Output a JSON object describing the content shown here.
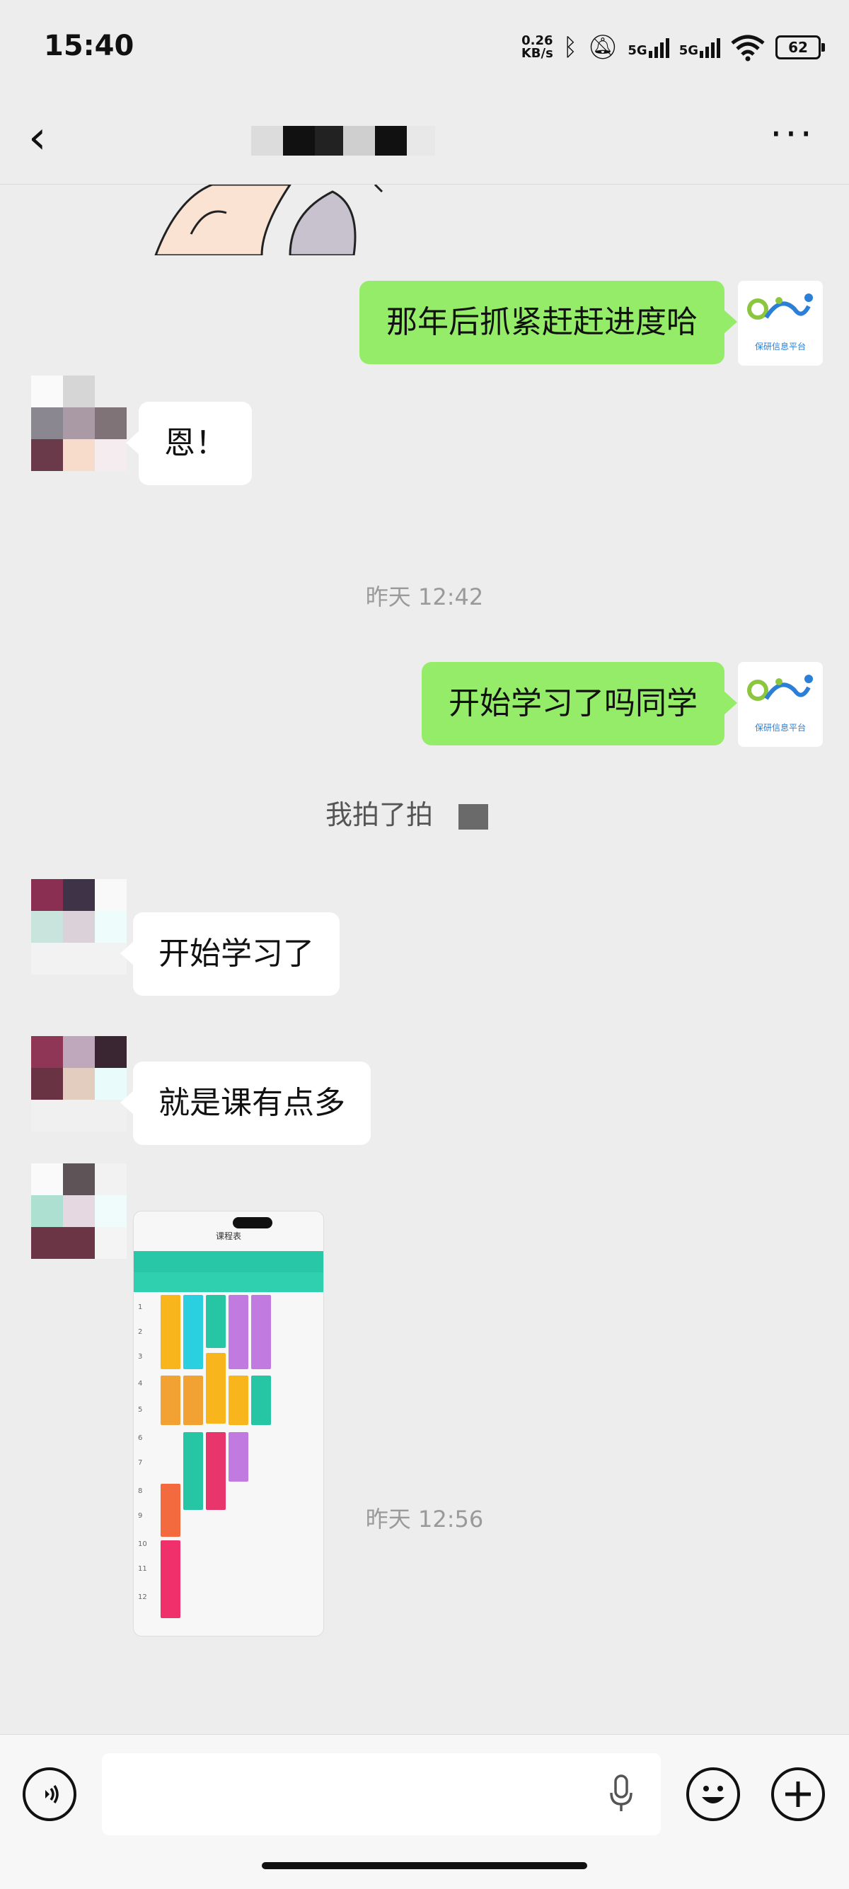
{
  "status_bar": {
    "time": "15:40",
    "net_speed_value": "0.26",
    "net_speed_unit": "KB/s",
    "sim1": "5G",
    "sim2": "5G",
    "battery": "62",
    "icons": [
      "bluetooth-icon",
      "mute-bell-icon",
      "signal-icon",
      "wifi-icon",
      "battery-icon"
    ]
  },
  "header": {
    "back_icon": "‹",
    "more_icon": "···"
  },
  "messages": [
    {
      "side": "out",
      "text": "那年后抓紧赶赶进度哈"
    },
    {
      "side": "in",
      "text": "恩！"
    },
    {
      "type": "time",
      "text": "昨天 12:42"
    },
    {
      "side": "out",
      "text": "开始学习了吗同学"
    },
    {
      "type": "system",
      "text": "我拍了拍"
    },
    {
      "side": "in",
      "text": "开始学习了"
    },
    {
      "side": "in",
      "text": "就是课有点多"
    },
    {
      "side": "in",
      "type": "image",
      "alt": "课程表"
    },
    {
      "type": "time",
      "text": "昨天 12:56"
    }
  ],
  "brand_avatar": {
    "label": "保研信息平台"
  },
  "schedule_image": {
    "title": "课程表",
    "row_numbers": [
      "1",
      "2",
      "3",
      "4",
      "5",
      "6",
      "7",
      "8",
      "9",
      "10",
      "11",
      "12"
    ]
  },
  "colors": {
    "background": "#ededed",
    "bubble_out": "#95ec69",
    "bubble_in": "#ffffff",
    "teal": "#27c7a8"
  },
  "input": {
    "placeholder": "",
    "value": ""
  }
}
